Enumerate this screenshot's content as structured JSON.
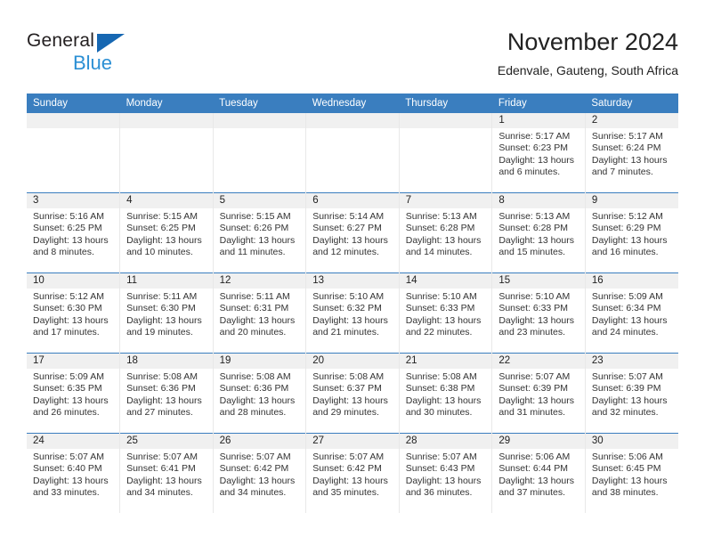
{
  "brand": {
    "name_top": "General",
    "name_bottom": "Blue",
    "accent_color": "#1667b2",
    "accent_color_light": "#2b8fd4"
  },
  "header": {
    "title": "November 2024",
    "subtitle": "Edenvale, Gauteng, South Africa"
  },
  "theme": {
    "header_row_bg": "#3a7ebf",
    "daynum_band_bg": "#f0f0f0",
    "row_divider": "#3a7ebf"
  },
  "weekdays": [
    "Sunday",
    "Monday",
    "Tuesday",
    "Wednesday",
    "Thursday",
    "Friday",
    "Saturday"
  ],
  "labels": {
    "sunrise_prefix": "Sunrise:",
    "sunset_prefix": "Sunset:",
    "daylight_prefix": "Daylight:"
  },
  "weeks": [
    [
      {
        "day": "",
        "empty": true
      },
      {
        "day": "",
        "empty": true
      },
      {
        "day": "",
        "empty": true
      },
      {
        "day": "",
        "empty": true
      },
      {
        "day": "",
        "empty": true
      },
      {
        "day": "1",
        "sunrise": "Sunrise: 5:17 AM",
        "sunset": "Sunset: 6:23 PM",
        "daylight": "Daylight: 13 hours and 6 minutes."
      },
      {
        "day": "2",
        "sunrise": "Sunrise: 5:17 AM",
        "sunset": "Sunset: 6:24 PM",
        "daylight": "Daylight: 13 hours and 7 minutes."
      }
    ],
    [
      {
        "day": "3",
        "sunrise": "Sunrise: 5:16 AM",
        "sunset": "Sunset: 6:25 PM",
        "daylight": "Daylight: 13 hours and 8 minutes."
      },
      {
        "day": "4",
        "sunrise": "Sunrise: 5:15 AM",
        "sunset": "Sunset: 6:25 PM",
        "daylight": "Daylight: 13 hours and 10 minutes."
      },
      {
        "day": "5",
        "sunrise": "Sunrise: 5:15 AM",
        "sunset": "Sunset: 6:26 PM",
        "daylight": "Daylight: 13 hours and 11 minutes."
      },
      {
        "day": "6",
        "sunrise": "Sunrise: 5:14 AM",
        "sunset": "Sunset: 6:27 PM",
        "daylight": "Daylight: 13 hours and 12 minutes."
      },
      {
        "day": "7",
        "sunrise": "Sunrise: 5:13 AM",
        "sunset": "Sunset: 6:28 PM",
        "daylight": "Daylight: 13 hours and 14 minutes."
      },
      {
        "day": "8",
        "sunrise": "Sunrise: 5:13 AM",
        "sunset": "Sunset: 6:28 PM",
        "daylight": "Daylight: 13 hours and 15 minutes."
      },
      {
        "day": "9",
        "sunrise": "Sunrise: 5:12 AM",
        "sunset": "Sunset: 6:29 PM",
        "daylight": "Daylight: 13 hours and 16 minutes."
      }
    ],
    [
      {
        "day": "10",
        "sunrise": "Sunrise: 5:12 AM",
        "sunset": "Sunset: 6:30 PM",
        "daylight": "Daylight: 13 hours and 17 minutes."
      },
      {
        "day": "11",
        "sunrise": "Sunrise: 5:11 AM",
        "sunset": "Sunset: 6:30 PM",
        "daylight": "Daylight: 13 hours and 19 minutes."
      },
      {
        "day": "12",
        "sunrise": "Sunrise: 5:11 AM",
        "sunset": "Sunset: 6:31 PM",
        "daylight": "Daylight: 13 hours and 20 minutes."
      },
      {
        "day": "13",
        "sunrise": "Sunrise: 5:10 AM",
        "sunset": "Sunset: 6:32 PM",
        "daylight": "Daylight: 13 hours and 21 minutes."
      },
      {
        "day": "14",
        "sunrise": "Sunrise: 5:10 AM",
        "sunset": "Sunset: 6:33 PM",
        "daylight": "Daylight: 13 hours and 22 minutes."
      },
      {
        "day": "15",
        "sunrise": "Sunrise: 5:10 AM",
        "sunset": "Sunset: 6:33 PM",
        "daylight": "Daylight: 13 hours and 23 minutes."
      },
      {
        "day": "16",
        "sunrise": "Sunrise: 5:09 AM",
        "sunset": "Sunset: 6:34 PM",
        "daylight": "Daylight: 13 hours and 24 minutes."
      }
    ],
    [
      {
        "day": "17",
        "sunrise": "Sunrise: 5:09 AM",
        "sunset": "Sunset: 6:35 PM",
        "daylight": "Daylight: 13 hours and 26 minutes."
      },
      {
        "day": "18",
        "sunrise": "Sunrise: 5:08 AM",
        "sunset": "Sunset: 6:36 PM",
        "daylight": "Daylight: 13 hours and 27 minutes."
      },
      {
        "day": "19",
        "sunrise": "Sunrise: 5:08 AM",
        "sunset": "Sunset: 6:36 PM",
        "daylight": "Daylight: 13 hours and 28 minutes."
      },
      {
        "day": "20",
        "sunrise": "Sunrise: 5:08 AM",
        "sunset": "Sunset: 6:37 PM",
        "daylight": "Daylight: 13 hours and 29 minutes."
      },
      {
        "day": "21",
        "sunrise": "Sunrise: 5:08 AM",
        "sunset": "Sunset: 6:38 PM",
        "daylight": "Daylight: 13 hours and 30 minutes."
      },
      {
        "day": "22",
        "sunrise": "Sunrise: 5:07 AM",
        "sunset": "Sunset: 6:39 PM",
        "daylight": "Daylight: 13 hours and 31 minutes."
      },
      {
        "day": "23",
        "sunrise": "Sunrise: 5:07 AM",
        "sunset": "Sunset: 6:39 PM",
        "daylight": "Daylight: 13 hours and 32 minutes."
      }
    ],
    [
      {
        "day": "24",
        "sunrise": "Sunrise: 5:07 AM",
        "sunset": "Sunset: 6:40 PM",
        "daylight": "Daylight: 13 hours and 33 minutes."
      },
      {
        "day": "25",
        "sunrise": "Sunrise: 5:07 AM",
        "sunset": "Sunset: 6:41 PM",
        "daylight": "Daylight: 13 hours and 34 minutes."
      },
      {
        "day": "26",
        "sunrise": "Sunrise: 5:07 AM",
        "sunset": "Sunset: 6:42 PM",
        "daylight": "Daylight: 13 hours and 34 minutes."
      },
      {
        "day": "27",
        "sunrise": "Sunrise: 5:07 AM",
        "sunset": "Sunset: 6:42 PM",
        "daylight": "Daylight: 13 hours and 35 minutes."
      },
      {
        "day": "28",
        "sunrise": "Sunrise: 5:07 AM",
        "sunset": "Sunset: 6:43 PM",
        "daylight": "Daylight: 13 hours and 36 minutes."
      },
      {
        "day": "29",
        "sunrise": "Sunrise: 5:06 AM",
        "sunset": "Sunset: 6:44 PM",
        "daylight": "Daylight: 13 hours and 37 minutes."
      },
      {
        "day": "30",
        "sunrise": "Sunrise: 5:06 AM",
        "sunset": "Sunset: 6:45 PM",
        "daylight": "Daylight: 13 hours and 38 minutes."
      }
    ]
  ]
}
